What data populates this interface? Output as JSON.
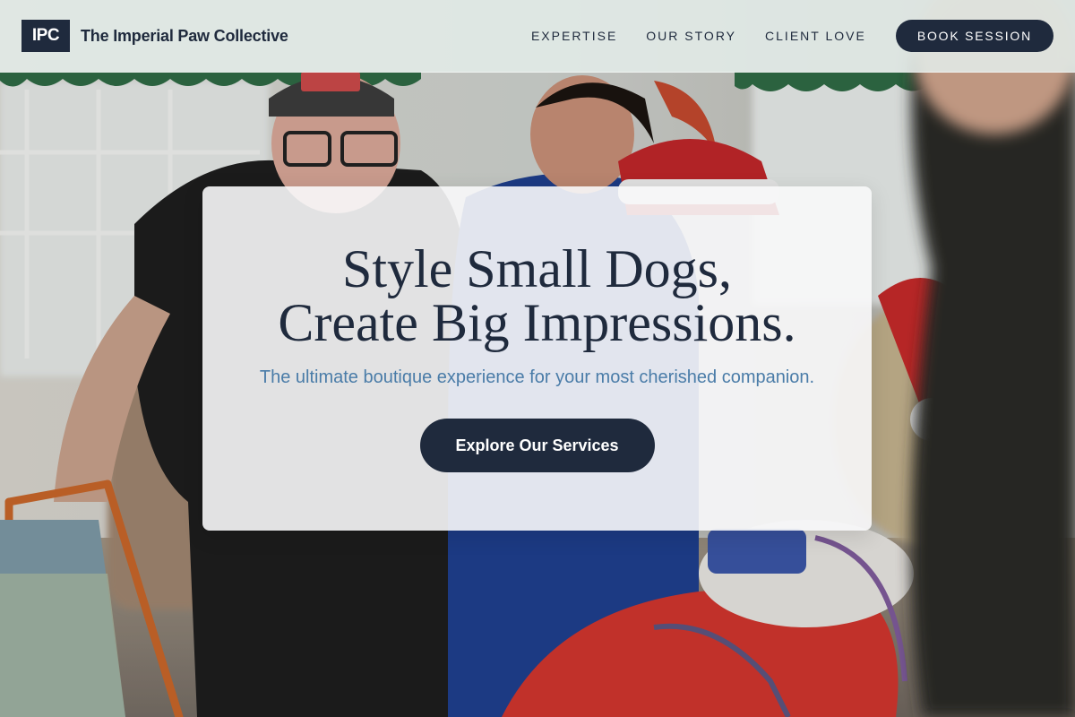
{
  "header": {
    "logo_text": "IPC",
    "brand_name": "The Imperial Paw Collective",
    "nav": [
      {
        "label": "EXPERTISE"
      },
      {
        "label": "OUR STORY"
      },
      {
        "label": "CLIENT LOVE"
      }
    ],
    "cta_label": "BOOK SESSION"
  },
  "hero": {
    "title_line1": "Style Small Dogs,",
    "title_line2": "Create Big Impressions.",
    "subtitle": "The ultimate boutique experience for your most cherished companion.",
    "button_label": "Explore Our Services",
    "background_image": "photo-people-with-dogs-in-costumes"
  },
  "colors": {
    "navy": "#1f2a3d",
    "accent_blue": "#4a7ca8",
    "header_bg": "#e2ece8",
    "card_bg": "#f8f8fa"
  }
}
